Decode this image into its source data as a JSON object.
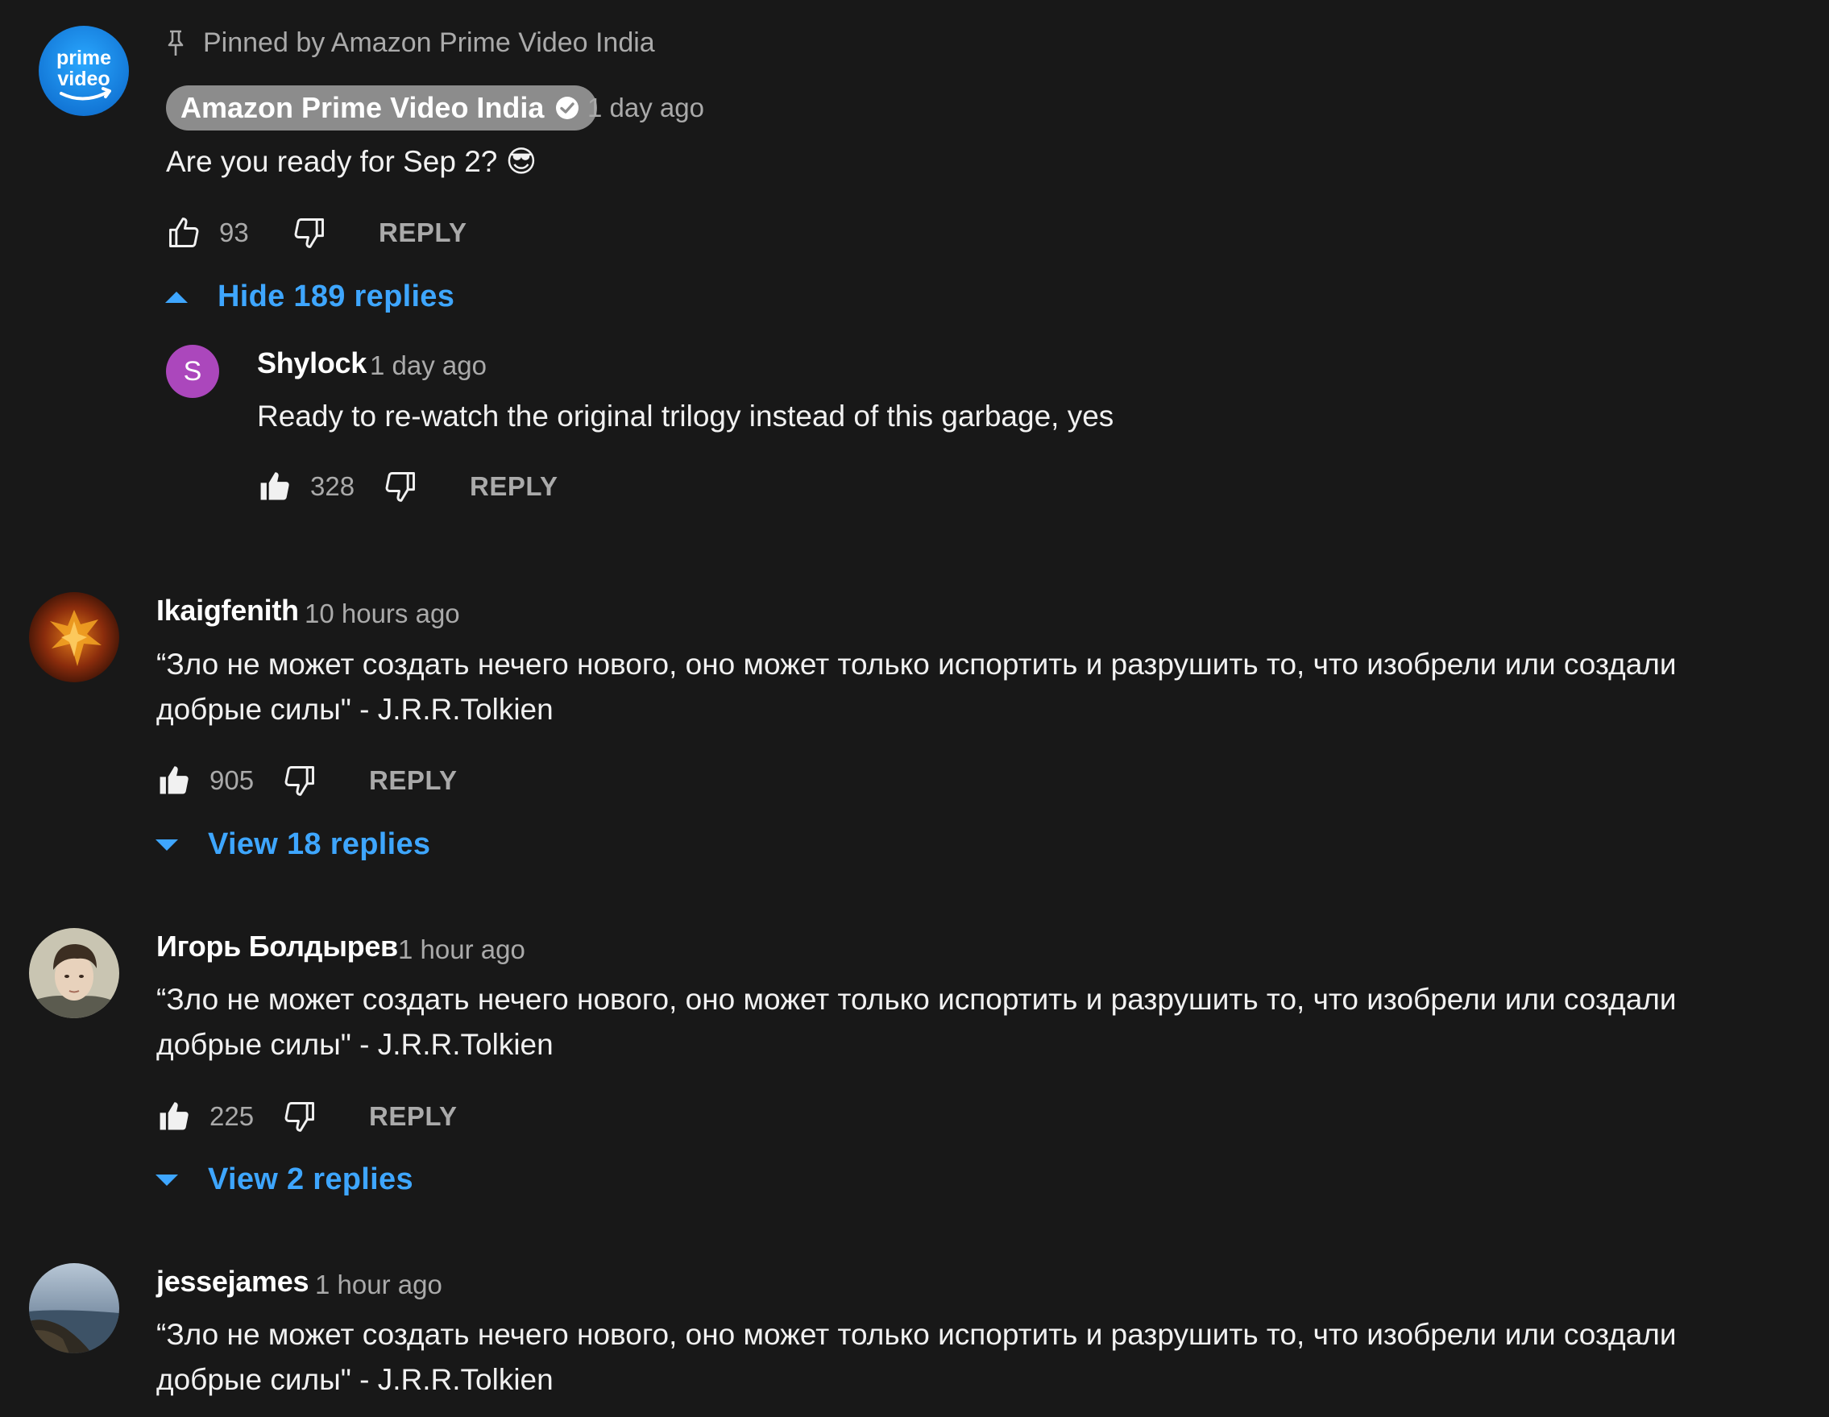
{
  "pinned_comment": {
    "pinned_label": "Pinned by Amazon Prime Video India",
    "avatar_text_top": "prime",
    "avatar_text_bottom": "video",
    "author": "Amazon Prime Video India",
    "time": "1 day ago",
    "text": "Are you ready for Sep 2? 😎",
    "likes": "93",
    "reply_label": "REPLY",
    "toggle_label": "Hide 189 replies",
    "reply": {
      "avatar_letter": "S",
      "author": "Shylock",
      "time": "1 day ago",
      "text": "Ready to re-watch the original trilogy instead of this garbage, yes",
      "likes": "328",
      "reply_label": "REPLY"
    }
  },
  "comments": [
    {
      "author": "Ikaigfenith",
      "time": "10 hours ago",
      "text_line1": "“Зло не может создать нечего нового, оно может только испортить и разрушить то, что изобрели или создали",
      "text_line2": "добрые силы\" - J.R.R.Tolkien",
      "likes": "905",
      "reply_label": "REPLY",
      "toggle_label": "View 18 replies"
    },
    {
      "author": "Игорь Болдырев",
      "time": "1 hour ago",
      "text_line1": "“Зло не может создать нечего нового, оно может только испортить и разрушить то, что изобрели или создали",
      "text_line2": "добрые силы\" - J.R.R.Tolkien",
      "likes": "225",
      "reply_label": "REPLY",
      "toggle_label": "View 2 replies"
    },
    {
      "author": "jessejames",
      "time": "1 hour ago",
      "text_line1": "“Зло не может создать нечего нового, оно может только испортить и разрушить то, что изобрели или создали",
      "text_line2": "добрые силы\" - J.R.R.Tolkien"
    }
  ],
  "colors": {
    "background": "#181818",
    "link_blue": "#3ea6ff",
    "secondary_text": "#aaaaaa",
    "prime_blue": "#1a98ff",
    "shylock_purple": "#ab47bc"
  },
  "icons": [
    "pin-icon",
    "verified-icon",
    "like-icon",
    "dislike-icon",
    "caret-up-icon",
    "caret-down-icon"
  ]
}
